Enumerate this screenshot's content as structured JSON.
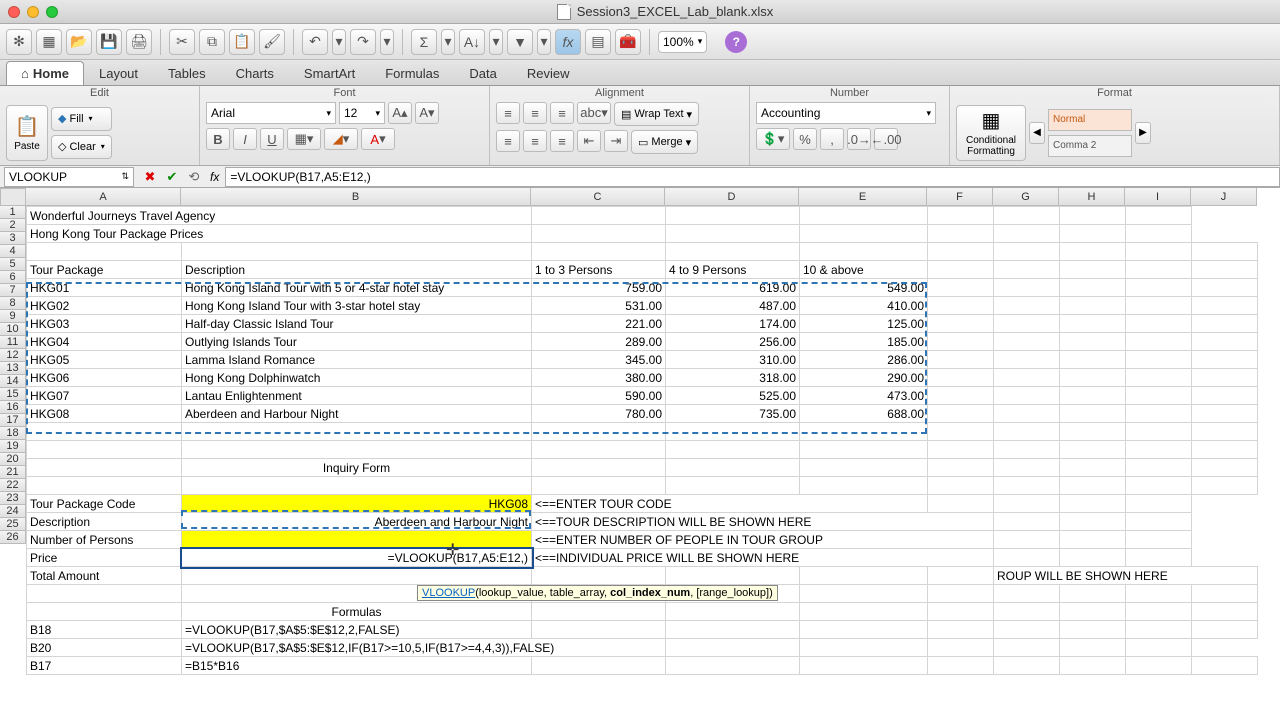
{
  "title": "Session3_EXCEL_Lab_blank.xlsx",
  "zoom": "100%",
  "tabs": [
    "Home",
    "Layout",
    "Tables",
    "Charts",
    "SmartArt",
    "Formulas",
    "Data",
    "Review"
  ],
  "groups": [
    "Edit",
    "Font",
    "Alignment",
    "Number",
    "Format"
  ],
  "edit": {
    "paste": "Paste",
    "fill": "Fill",
    "clear": "Clear"
  },
  "font": {
    "name": "Arial",
    "size": "12"
  },
  "align": {
    "wrap": "Wrap Text",
    "merge": "Merge"
  },
  "number": {
    "format": "Accounting"
  },
  "format": {
    "cond": "Conditional Formatting",
    "s1": "Normal",
    "s2": "Comma 2"
  },
  "namebox": "VLOOKUP",
  "formula": "=VLOOKUP(B17,A5:E12,)",
  "fx": "fx",
  "tooltip": {
    "fn": "VLOOKUP",
    "args": "(lookup_value, table_array, ",
    "hi": "col_index_num",
    "rest": ", [range_lookup])"
  },
  "cols": [
    "A",
    "B",
    "C",
    "D",
    "E",
    "F",
    "G",
    "H",
    "I",
    "J"
  ],
  "rows": {
    "1": {
      "A": "Wonderful Journeys Travel Agency"
    },
    "2": {
      "A": "Hong Kong Tour Package Prices"
    },
    "4": {
      "A": "Tour Package",
      "B": "Description",
      "C": "1 to 3 Persons",
      "D": "4 to 9 Persons",
      "E": "10 & above"
    },
    "5": {
      "A": "HKG01",
      "B": "Hong Kong Island Tour with  5 or 4-star hotel stay",
      "C": "759.00",
      "D": "619.00",
      "E": "549.00"
    },
    "6": {
      "A": "HKG02",
      "B": "Hong Kong Island Tour with 3-star hotel stay",
      "C": "531.00",
      "D": "487.00",
      "E": "410.00"
    },
    "7": {
      "A": "HKG03",
      "B": "Half-day Classic Island Tour",
      "C": "221.00",
      "D": "174.00",
      "E": "125.00"
    },
    "8": {
      "A": "HKG04",
      "B": "Outlying Islands Tour",
      "C": "289.00",
      "D": "256.00",
      "E": "185.00"
    },
    "9": {
      "A": "HKG05",
      "B": "Lamma Island Romance",
      "C": "345.00",
      "D": "310.00",
      "E": "286.00"
    },
    "10": {
      "A": "HKG06",
      "B": "Hong Kong Dolphinwatch",
      "C": "380.00",
      "D": "318.00",
      "E": "290.00"
    },
    "11": {
      "A": "HKG07",
      "B": "Lantau Enlightenment",
      "C": "590.00",
      "D": "525.00",
      "E": "473.00"
    },
    "12": {
      "A": "HKG08",
      "B": "Aberdeen and Harbour Night",
      "C": "780.00",
      "D": "735.00",
      "E": "688.00"
    },
    "15": {
      "B": "Inquiry Form"
    },
    "17": {
      "A": "Tour Package Code",
      "B": "HKG08",
      "C": "<==ENTER TOUR CODE"
    },
    "18": {
      "A": "Description",
      "B": "Aberdeen and Harbour Night",
      "C": "<==TOUR DESCRIPTION WILL BE SHOWN HERE"
    },
    "19": {
      "A": "Number of Persons",
      "C": "<==ENTER NUMBER OF PEOPLE IN TOUR GROUP"
    },
    "20": {
      "A": "Price",
      "B": "=VLOOKUP(B17,A5:E12,)",
      "C": "<==INDIVIDUAL PRICE WILL BE SHOWN HERE"
    },
    "21": {
      "A": "Total Amount",
      "C": "ROUP WILL BE SHOWN HERE"
    },
    "23": {
      "B": "Formulas"
    },
    "24": {
      "A": "B18",
      "B": "=VLOOKUP(B17,$A$5:$E$12,2,FALSE)"
    },
    "25": {
      "A": "B20",
      "B": "=VLOOKUP(B17,$A$5:$E$12,IF(B17>=10,5,IF(B17>=4,4,3)),FALSE)"
    },
    "26": {
      "A": "B17",
      "B": "=B15*B16"
    }
  }
}
